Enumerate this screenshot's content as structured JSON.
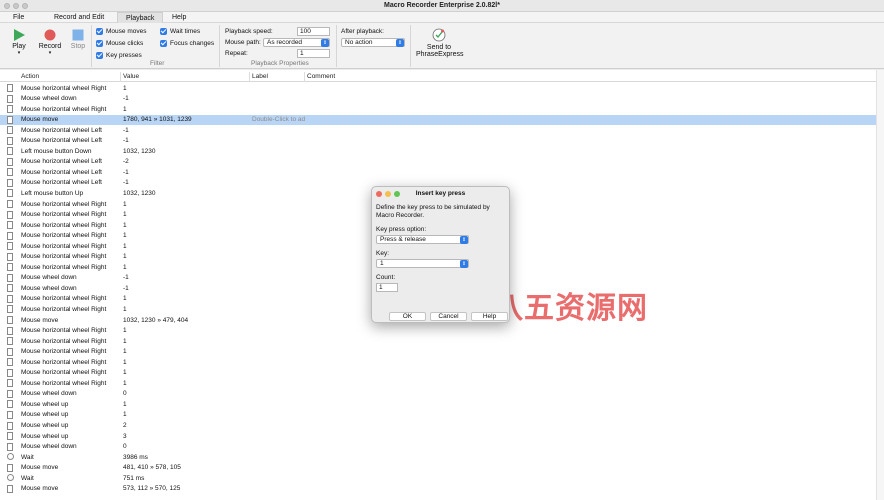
{
  "window": {
    "title": "Macro Recorder Enterprise 2.0.82l*"
  },
  "menu": {
    "file": "File",
    "record_edit": "Record and Edit",
    "playback": "Playback",
    "help": "Help"
  },
  "ribbon": {
    "play": "Play",
    "record": "Record",
    "stop": "Stop",
    "filter": {
      "mouse_moves": "Mouse moves",
      "mouse_clicks": "Mouse clicks",
      "key_presses": "Key presses",
      "wait_times": "Wait times",
      "focus_changes": "Focus changes",
      "label": "Filter"
    },
    "props": {
      "speed_label": "Playback speed:",
      "speed_value": "100",
      "path_label": "Mouse path:",
      "path_value": "As recorded",
      "repeat_label": "Repeat:",
      "repeat_value": "1",
      "label": "Playback Properties"
    },
    "after": {
      "label": "After playback:",
      "value": "No action"
    },
    "send": {
      "line1": "Send to",
      "line2": "PhraseExpress"
    }
  },
  "grid": {
    "headers": {
      "action": "Action",
      "value": "Value",
      "label": "Label",
      "comment": "Comment"
    },
    "rows": [
      {
        "action": "Mouse horizontal wheel Right",
        "value": "1",
        "icon": "doc"
      },
      {
        "action": "Mouse wheel down",
        "value": "-1",
        "icon": "doc"
      },
      {
        "action": "Mouse horizontal wheel Right",
        "value": "1",
        "icon": "doc"
      },
      {
        "action": "Mouse move",
        "value": "1780, 941 » 1031, 1239",
        "icon": "doc",
        "selected": true,
        "hint": "Double-Click to ad"
      },
      {
        "action": "Mouse horizontal wheel Left",
        "value": "-1",
        "icon": "doc"
      },
      {
        "action": "Mouse horizontal wheel Left",
        "value": "-1",
        "icon": "doc"
      },
      {
        "action": "Left mouse button Down",
        "value": "1032, 1230",
        "icon": "doc"
      },
      {
        "action": "Mouse horizontal wheel Left",
        "value": "-2",
        "icon": "doc"
      },
      {
        "action": "Mouse horizontal wheel Left",
        "value": "-1",
        "icon": "doc"
      },
      {
        "action": "Mouse horizontal wheel Left",
        "value": "-1",
        "icon": "doc"
      },
      {
        "action": "Left mouse button Up",
        "value": "1032, 1230",
        "icon": "doc"
      },
      {
        "action": "Mouse horizontal wheel Right",
        "value": "1",
        "icon": "doc"
      },
      {
        "action": "Mouse horizontal wheel Right",
        "value": "1",
        "icon": "doc"
      },
      {
        "action": "Mouse horizontal wheel Right",
        "value": "1",
        "icon": "doc"
      },
      {
        "action": "Mouse horizontal wheel Right",
        "value": "1",
        "icon": "doc"
      },
      {
        "action": "Mouse horizontal wheel Right",
        "value": "1",
        "icon": "doc"
      },
      {
        "action": "Mouse horizontal wheel Right",
        "value": "1",
        "icon": "doc"
      },
      {
        "action": "Mouse horizontal wheel Right",
        "value": "1",
        "icon": "doc"
      },
      {
        "action": "Mouse wheel down",
        "value": "-1",
        "icon": "doc"
      },
      {
        "action": "Mouse wheel down",
        "value": "-1",
        "icon": "doc"
      },
      {
        "action": "Mouse horizontal wheel Right",
        "value": "1",
        "icon": "doc"
      },
      {
        "action": "Mouse horizontal wheel Right",
        "value": "1",
        "icon": "doc"
      },
      {
        "action": "Mouse move",
        "value": "1032, 1230 » 479, 404",
        "icon": "doc"
      },
      {
        "action": "Mouse horizontal wheel Right",
        "value": "1",
        "icon": "doc"
      },
      {
        "action": "Mouse horizontal wheel Right",
        "value": "1",
        "icon": "doc"
      },
      {
        "action": "Mouse horizontal wheel Right",
        "value": "1",
        "icon": "doc"
      },
      {
        "action": "Mouse horizontal wheel Right",
        "value": "1",
        "icon": "doc"
      },
      {
        "action": "Mouse horizontal wheel Right",
        "value": "1",
        "icon": "doc"
      },
      {
        "action": "Mouse horizontal wheel Right",
        "value": "1",
        "icon": "doc"
      },
      {
        "action": "Mouse wheel down",
        "value": "0",
        "icon": "doc"
      },
      {
        "action": "Mouse wheel up",
        "value": "1",
        "icon": "doc"
      },
      {
        "action": "Mouse wheel up",
        "value": "1",
        "icon": "doc"
      },
      {
        "action": "Mouse wheel up",
        "value": "2",
        "icon": "doc"
      },
      {
        "action": "Mouse wheel up",
        "value": "3",
        "icon": "doc"
      },
      {
        "action": "Mouse wheel down",
        "value": "0",
        "icon": "doc"
      },
      {
        "action": "Wait",
        "value": "3986 ms",
        "icon": "clock"
      },
      {
        "action": "Mouse move",
        "value": "481, 410 » 578, 105",
        "icon": "doc"
      },
      {
        "action": "Wait",
        "value": "751 ms",
        "icon": "clock"
      },
      {
        "action": "Mouse move",
        "value": "573, 112 » 570, 125",
        "icon": "doc"
      }
    ]
  },
  "dialog": {
    "title": "Insert key press",
    "description": "Define the key press to be simulated by Macro Recorder.",
    "option_label": "Key press option:",
    "option_value": "Press & release",
    "key_label": "Key:",
    "key_value": "1",
    "count_label": "Count:",
    "count_value": "1",
    "ok": "OK",
    "cancel": "Cancel",
    "help": "Help"
  },
  "watermark": "九八五资源网",
  "colors": {
    "accent": "#2f7ce6",
    "selection": "#b9d5f5",
    "play": "#3ea85a",
    "record": "#e05a5a",
    "stop": "#7fb2e8",
    "watermark": "#e13c3c"
  }
}
